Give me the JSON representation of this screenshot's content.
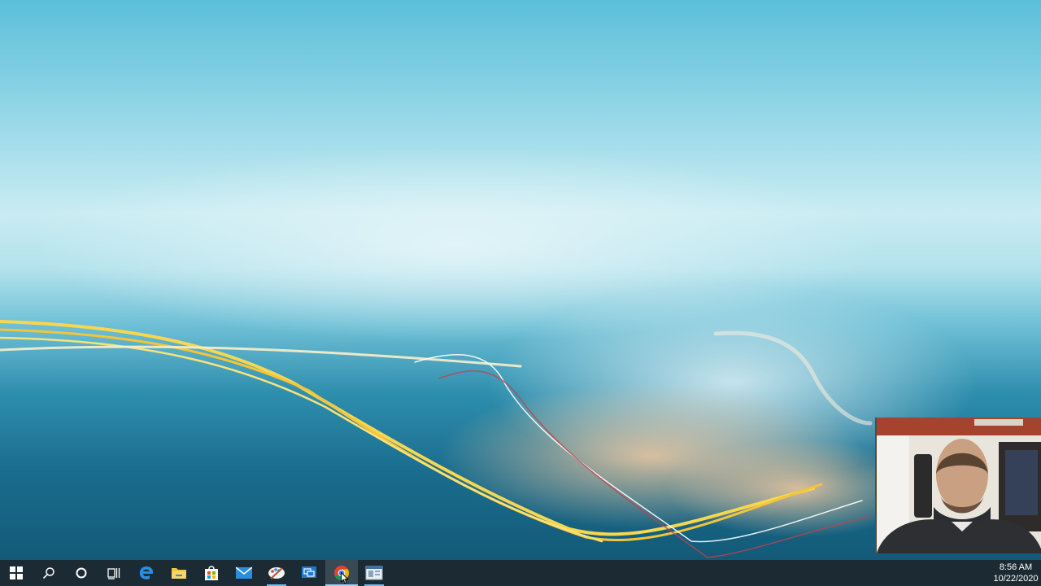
{
  "taskbar": {
    "buttons": [
      {
        "name": "start-button",
        "icon": "windows-icon"
      },
      {
        "name": "search-button",
        "icon": "search-icon"
      },
      {
        "name": "cortana-button",
        "icon": "cortana-circle-icon"
      },
      {
        "name": "task-view-button",
        "icon": "task-view-icon"
      },
      {
        "name": "edge-button",
        "icon": "edge-icon"
      },
      {
        "name": "file-explorer-button",
        "icon": "folder-icon"
      },
      {
        "name": "store-button",
        "icon": "store-bag-icon"
      },
      {
        "name": "mail-button",
        "icon": "mail-icon"
      },
      {
        "name": "paint-button",
        "icon": "paint-palette-icon",
        "running": true
      },
      {
        "name": "remote-desktop-button",
        "icon": "remote-desktop-icon"
      },
      {
        "name": "chrome-button",
        "icon": "chrome-icon",
        "running": true,
        "hovered": true
      },
      {
        "name": "app-window-button",
        "icon": "app-window-icon",
        "running": true
      }
    ],
    "colors": {
      "background": "#1c2a33",
      "active_indicator": "#76b9ed"
    }
  },
  "clock": {
    "time": "8:56 AM",
    "date": "10/22/2020"
  },
  "desktop": {
    "wallpaper": "light-trails-sky",
    "webcam_overlay": "presenter-webcam"
  }
}
